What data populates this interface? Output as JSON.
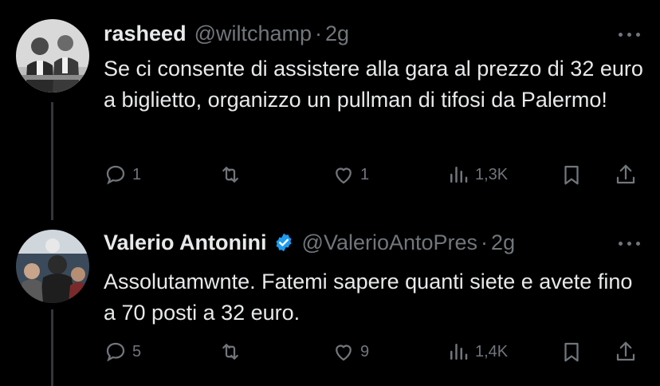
{
  "tweets": [
    {
      "name": "rasheed",
      "handle": "@wiltchamp",
      "time": "2g",
      "text": "Se ci consente di assistere alla gara al prezzo di 32 euro a biglietto, organizzo un pullman di tifosi da Palermo!",
      "replies": "1",
      "retweets": "",
      "likes": "1",
      "views": "1,3K",
      "verified": false,
      "avatar": "black-and-white-photo-avatar"
    },
    {
      "name": "Valerio Antonini",
      "handle": "@ValerioAntoPres",
      "time": "2g",
      "text": "Assolutamwnte. Fatemi sapere quanti siete e avete fino a 70 posti a 32 euro.",
      "replies": "5",
      "retweets": "",
      "likes": "9",
      "views": "1,4K",
      "verified": true,
      "avatar": "crowd-photo-avatar"
    }
  ],
  "colors": {
    "background": "#000000",
    "text": "#e7e9ea",
    "muted": "#71767b",
    "verified": "#1d9bf0"
  }
}
